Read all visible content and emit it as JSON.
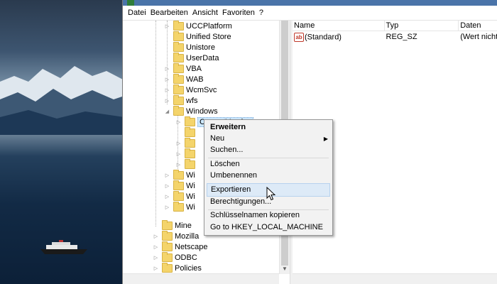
{
  "menubar": {
    "items": [
      "Datei",
      "Bearbeiten",
      "Ansicht",
      "Favoriten",
      "?"
    ]
  },
  "tree": {
    "items": [
      {
        "label": "UCCPlatform"
      },
      {
        "label": "Unified Store"
      },
      {
        "label": "Unistore"
      },
      {
        "label": "UserData"
      },
      {
        "label": "VBA"
      },
      {
        "label": "WAB"
      },
      {
        "label": "WcmSvc"
      },
      {
        "label": "wfs"
      },
      {
        "label": "Windows"
      },
      {
        "label": "CurrentVersion"
      },
      {
        "label": ""
      },
      {
        "label": ""
      },
      {
        "label": ""
      },
      {
        "label": ""
      },
      {
        "label": "Wi"
      },
      {
        "label": "Wi"
      },
      {
        "label": "Wi"
      },
      {
        "label": "Wi"
      },
      {
        "label": "Mine"
      },
      {
        "label": "Mozilla"
      },
      {
        "label": "Netscape"
      },
      {
        "label": "ODBC"
      },
      {
        "label": "Policies"
      }
    ]
  },
  "values": {
    "columns": [
      "Name",
      "Typ",
      "Daten"
    ],
    "rows": [
      {
        "name": "(Standard)",
        "type": "REG_SZ",
        "data": "(Wert nicht"
      }
    ]
  },
  "context_menu": {
    "items": [
      "Erweitern",
      "Neu",
      "Suchen...",
      "Löschen",
      "Umbenennen",
      "Exportieren",
      "Berechtigungen...",
      "Schlüsselnamen kopieren",
      "Go to HKEY_LOCAL_MACHINE"
    ]
  },
  "colors": {
    "titlebar": "#4a74a9",
    "folder": "#f4d46b",
    "menu_highlight": "#ddeaf7"
  }
}
